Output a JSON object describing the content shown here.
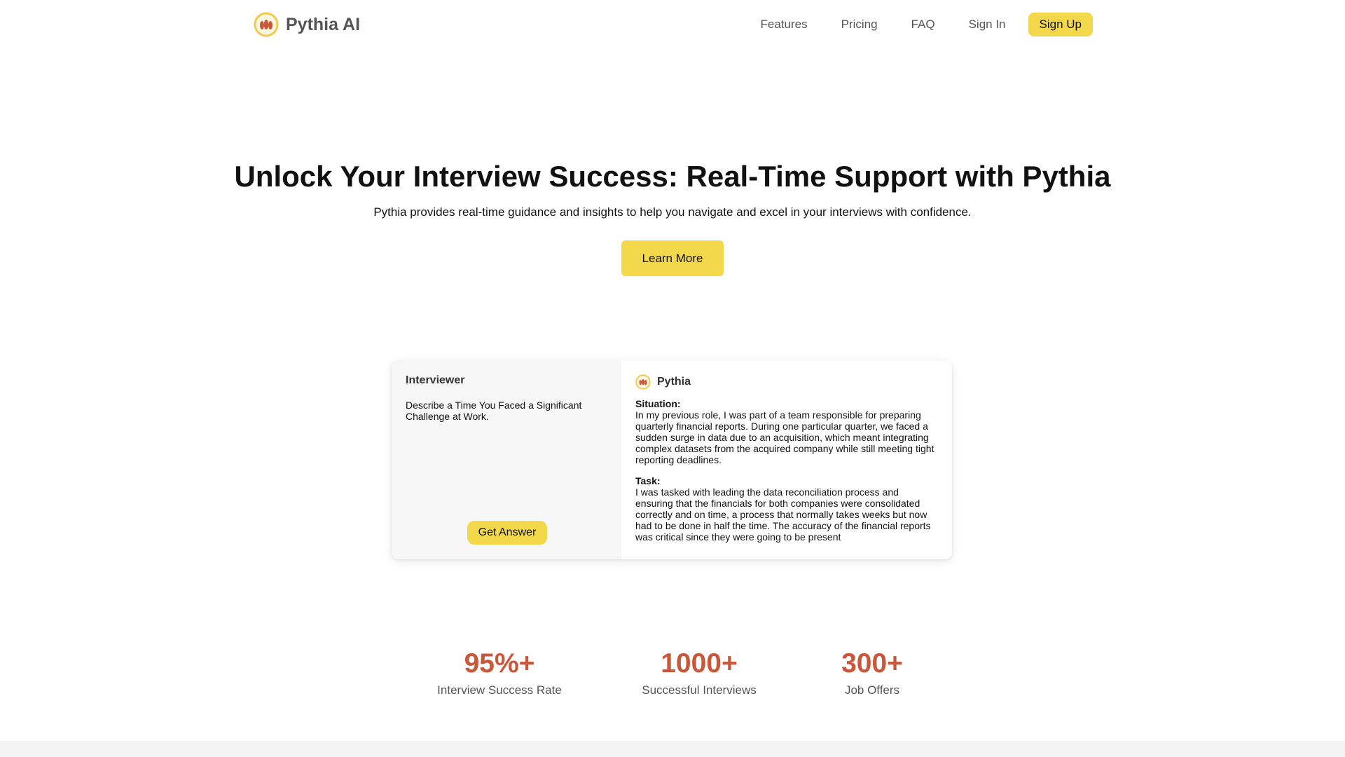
{
  "header": {
    "brand_name": "Pythia AI",
    "nav": [
      "Features",
      "Pricing",
      "FAQ",
      "Sign In"
    ],
    "signup_label": "Sign Up"
  },
  "hero": {
    "title": "Unlock Your Interview Success: Real-Time Support with Pythia",
    "subtitle": "Pythia provides real-time guidance and insights to help you navigate and excel in your interviews with confidence.",
    "cta_label": "Learn More"
  },
  "demo": {
    "interviewer_title": "Interviewer",
    "question": "Describe a Time You Faced a Significant Challenge at Work.",
    "answer_button": "Get Answer",
    "assistant_name": "Pythia",
    "sections": [
      {
        "label": "Situation:",
        "text": "In my previous role, I was part of a team responsible for preparing quarterly financial reports. During one particular quarter, we faced a sudden surge in data due to an acquisition, which meant integrating complex datasets from the acquired company while still meeting tight reporting deadlines."
      },
      {
        "label": "Task:",
        "text": "I was tasked with leading the data reconciliation process and ensuring that the financials for both companies were consolidated correctly and on time, a process that normally takes weeks but now had to be done in half the time. The accuracy of the financial reports was critical since they were going to be present"
      }
    ]
  },
  "stats": [
    {
      "value": "95%+",
      "label": "Interview Success Rate"
    },
    {
      "value": "1000+",
      "label": "Successful Interviews"
    },
    {
      "value": "300+",
      "label": "Job Offers"
    }
  ],
  "colors": {
    "accent_yellow": "#f2d84a",
    "stat_red": "#c9573a",
    "logo_ring": "#f2c94c",
    "logo_flame": "#c9573a"
  },
  "icons": {
    "logo": "pythia-logo-icon",
    "small_logo": "pythia-avatar-icon"
  }
}
